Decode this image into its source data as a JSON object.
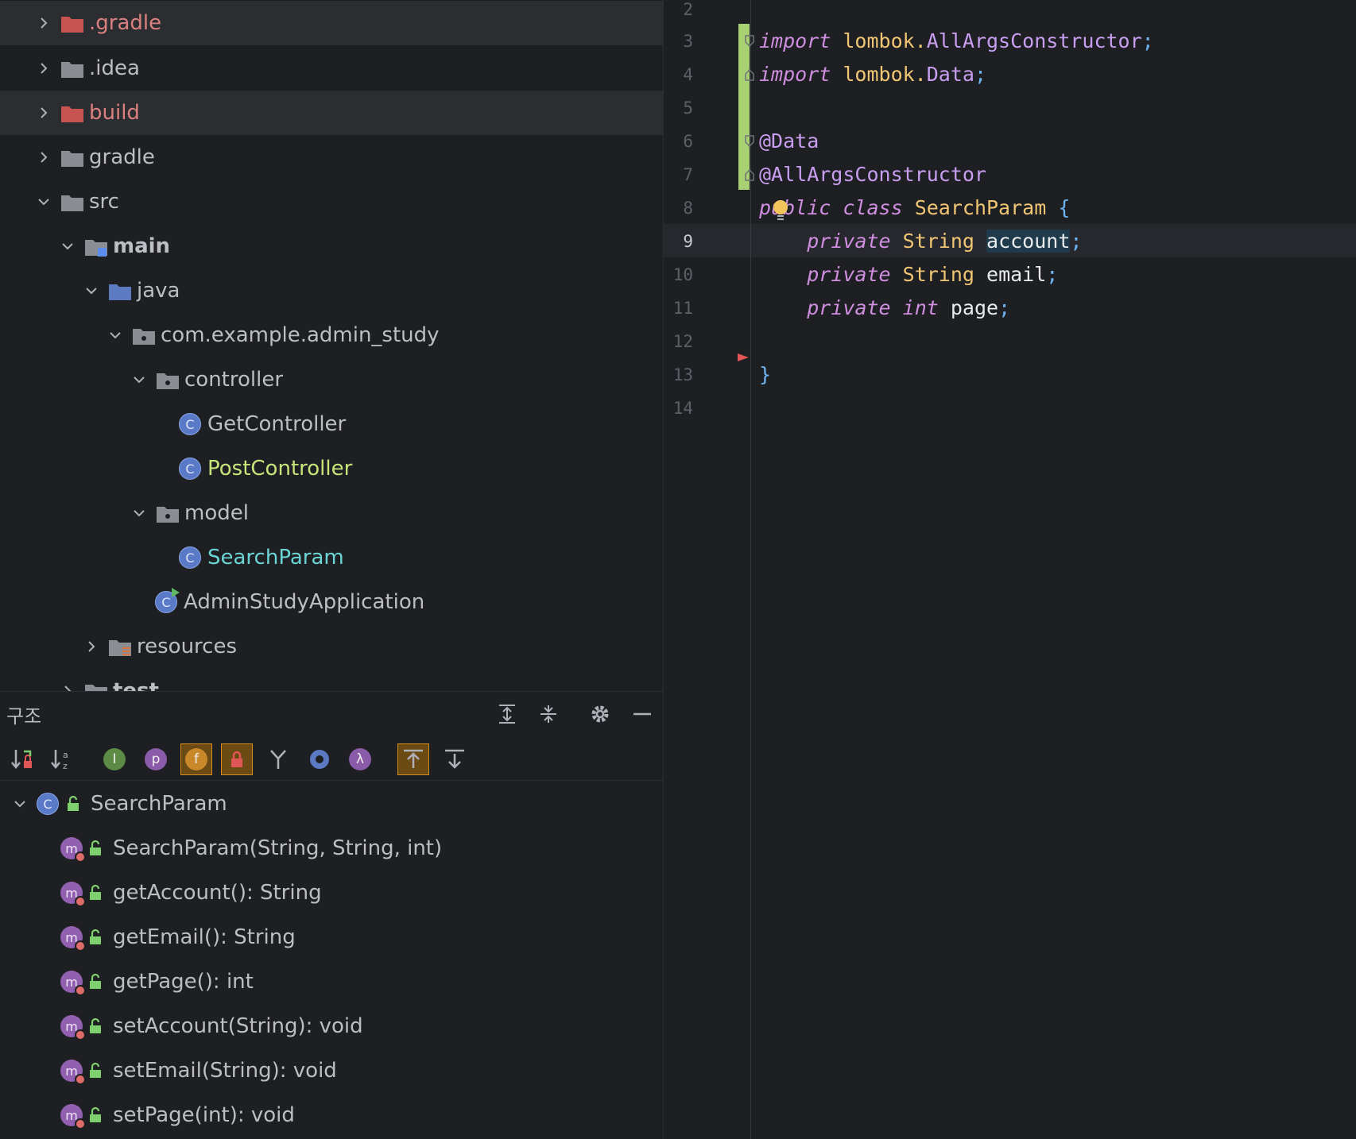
{
  "project_tree": {
    "items": [
      {
        "label": ".gradle",
        "color": "red",
        "expanded": false
      },
      {
        "label": ".idea",
        "color": "gray",
        "expanded": false
      },
      {
        "label": "build",
        "color": "red",
        "expanded": false
      },
      {
        "label": "gradle",
        "color": "gray",
        "expanded": false
      },
      {
        "label": "src",
        "color": "gray",
        "expanded": true
      },
      {
        "label": "main",
        "color": "gray",
        "expanded": true
      },
      {
        "label": "java",
        "color": "gray",
        "expanded": true
      },
      {
        "label": "com.example.admin_study",
        "color": "gray",
        "expanded": true
      },
      {
        "label": "controller",
        "color": "gray",
        "expanded": true
      },
      {
        "label": "GetController",
        "color": "gray"
      },
      {
        "label": "PostController",
        "color": "green"
      },
      {
        "label": "model",
        "color": "gray",
        "expanded": true
      },
      {
        "label": "SearchParam",
        "color": "teal"
      },
      {
        "label": "AdminStudyApplication",
        "color": "gray"
      },
      {
        "label": "resources",
        "color": "gray",
        "expanded": false
      },
      {
        "label": "test",
        "color": "gray",
        "expanded": false
      }
    ],
    "class_icon_letter": "C"
  },
  "structure": {
    "title": "구조",
    "root": {
      "label": "SearchParam",
      "icon_letter": "C"
    },
    "members": [
      "SearchParam(String, String, int)",
      "getAccount(): String",
      "getEmail(): String",
      "getPage(): int",
      "setAccount(String): void",
      "setEmail(String): void",
      "setPage(int): void"
    ],
    "member_icon_letter": "m",
    "toolbar_letters": {
      "interface": "I",
      "property": "p",
      "field": "f",
      "lambda": "λ"
    }
  },
  "editor": {
    "line_numbers": [
      "2",
      "3",
      "4",
      "5",
      "6",
      "7",
      "8",
      "9",
      "10",
      "11",
      "12",
      "13",
      "14"
    ],
    "current_line": "9",
    "lines": {
      "l3": {
        "kw": "import",
        "pkg": "lombok.",
        "cls": "AllArgsConstructor",
        "end": ";"
      },
      "l4": {
        "kw": "import",
        "pkg": "lombok.",
        "cls": "Data",
        "end": ";"
      },
      "l6": "@Data",
      "l7": "@AllArgsConstructor",
      "l8": {
        "kw1": "public",
        "kw2": "class",
        "name": "SearchParam",
        "brace": "{"
      },
      "l9": {
        "kw": "private",
        "type": "String",
        "name": "account",
        "end": ";"
      },
      "l10": {
        "kw": "private",
        "type": "String",
        "name": "email",
        "end": ";"
      },
      "l11": {
        "kw": "private",
        "type": "int",
        "name": "page",
        "end": ";"
      },
      "l13": "}"
    }
  },
  "colors": {
    "background": "#1e1f22",
    "change_bar": "#a8d174",
    "keyword": "#cf8ee0",
    "type": "#f0c674",
    "annotation": "#c79ef0"
  }
}
